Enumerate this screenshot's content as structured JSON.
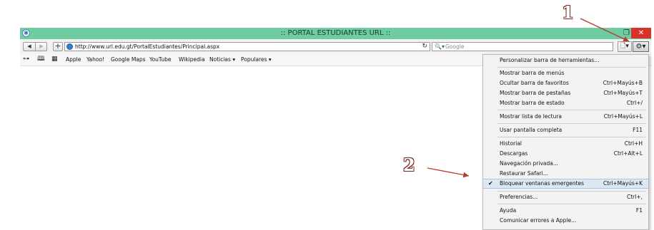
{
  "window": {
    "title": ":: PORTAL ESTUDIANTES URL ::",
    "restore_glyph": "❐",
    "close_glyph": "✕"
  },
  "toolbar": {
    "back_glyph": "◀",
    "forward_glyph": "▶",
    "new_tab_glyph": "+",
    "url": "http://www.url.edu.gt/PortalEstudiantes/Principal.aspx",
    "reload_glyph": "↻",
    "search_icon": "🔍▾",
    "search_placeholder": "Google",
    "page_icon": "🗋▾",
    "gear_icon": "⚙▾"
  },
  "favorites_bar": {
    "icons": [
      "reading-glasses-icon",
      "bookmarks-book-icon",
      "top-sites-grid-icon"
    ],
    "icon_glyphs": [
      "⊶",
      "🕮",
      "▦"
    ],
    "links": [
      "Apple",
      "Yahoo!",
      "Google Maps",
      "YouTube",
      "Wikipedia",
      "Noticias ▾",
      "Populares ▾"
    ]
  },
  "menu": {
    "items": [
      {
        "label": "Personalizar barra de herramientas...",
        "shortcut": ""
      },
      {
        "label": "Mostrar barra de menús",
        "shortcut": ""
      },
      {
        "label": "Ocultar barra de favoritos",
        "shortcut": "Ctrl+Mayús+B"
      },
      {
        "label": "Mostrar barra de pestañas",
        "shortcut": "Ctrl+Mayús+T"
      },
      {
        "label": "Mostrar barra de estado",
        "shortcut": "Ctrl+/"
      },
      {
        "label": "Mostrar lista de lectura",
        "shortcut": "Ctrl+Mayús+L"
      },
      {
        "label": "Usar pantalla completa",
        "shortcut": "F11"
      },
      {
        "label": "Historial",
        "shortcut": "Ctrl+H"
      },
      {
        "label": "Descargas",
        "shortcut": "Ctrl+Alt+L"
      },
      {
        "label": "Navegación privada...",
        "shortcut": ""
      },
      {
        "label": "Restaurar Safari...",
        "shortcut": ""
      },
      {
        "label": "Bloquear ventanas emergentes",
        "shortcut": "Ctrl+Mayús+K",
        "checked": true
      },
      {
        "label": "Preferencias...",
        "shortcut": "Ctrl+,"
      },
      {
        "label": "Ayuda",
        "shortcut": "F1"
      },
      {
        "label": "Comunicar errores a Apple...",
        "shortcut": ""
      }
    ],
    "check_glyph": "✔"
  },
  "annotations": {
    "step1": "1",
    "step2": "2",
    "arrow_color": "#b83a32"
  },
  "colors": {
    "titlebar": "#6fcba0",
    "close": "#d9322b",
    "highlight": "#dbe8f5"
  }
}
